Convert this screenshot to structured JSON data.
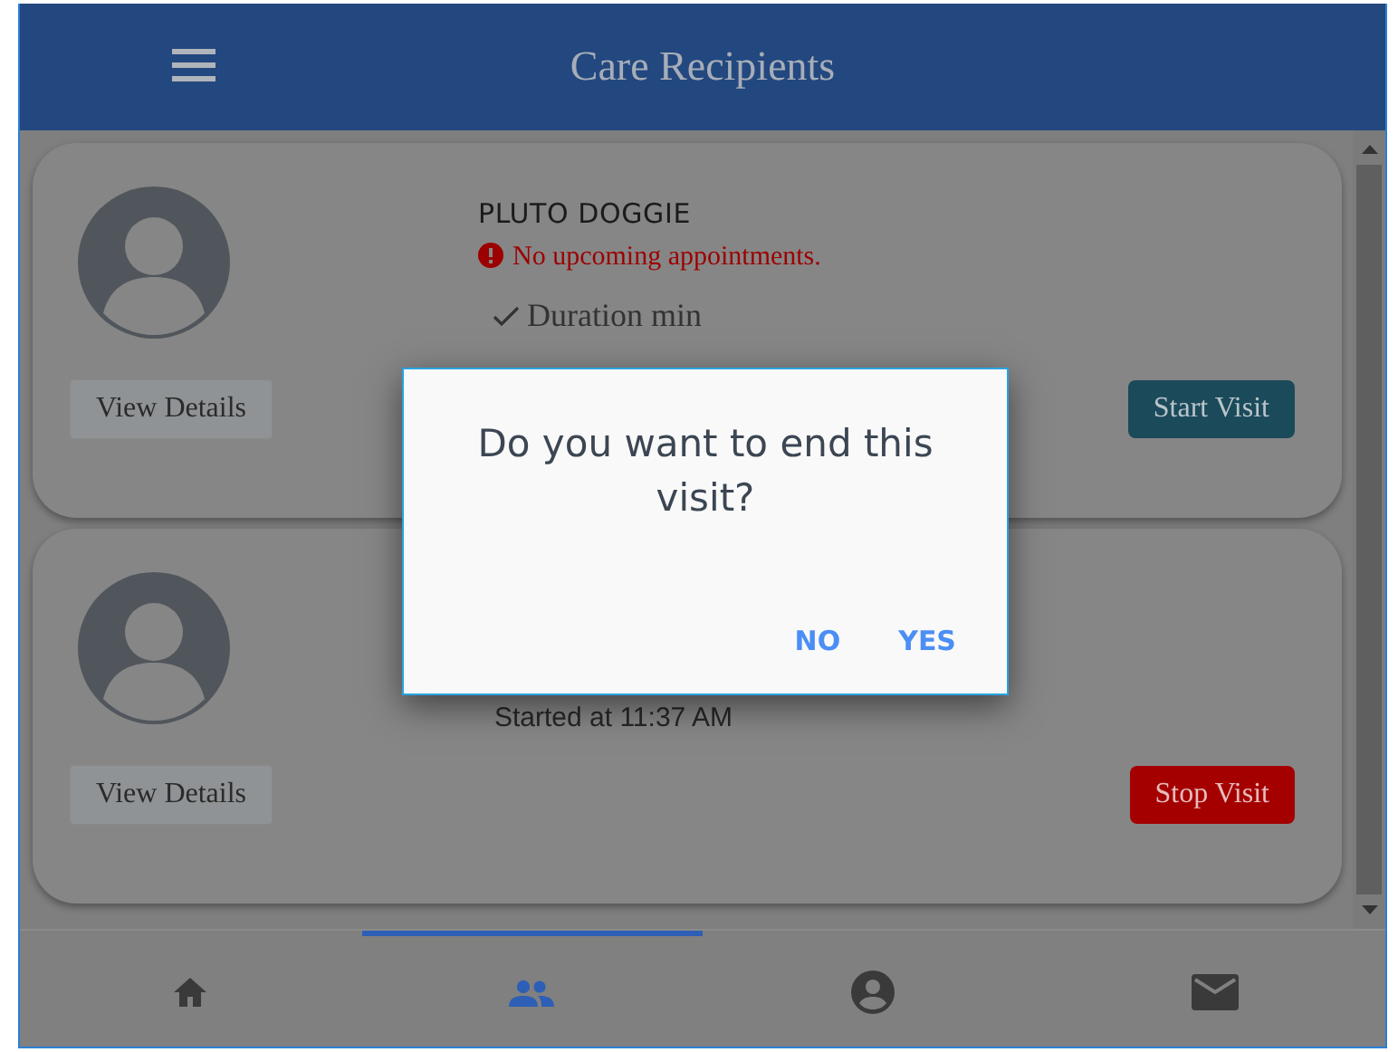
{
  "header": {
    "title": "Care Recipients"
  },
  "recipients": [
    {
      "name": "PLUTO DOGGIE",
      "status": "No upcoming appointments.",
      "detail": "Duration min",
      "checked": true,
      "details_button": "View Details",
      "action": {
        "label": "Start Visit",
        "kind": "start"
      }
    },
    {
      "detail": "Started at 11:37 AM",
      "checked": false,
      "details_button": "View Details",
      "action": {
        "label": "Stop Visit",
        "kind": "stop"
      }
    }
  ],
  "dialog": {
    "message": "Do you want to end this visit?",
    "buttons": [
      "NO",
      "YES"
    ]
  },
  "nav": [
    {
      "kind": "home",
      "selected": false
    },
    {
      "kind": "people",
      "selected": true
    },
    {
      "kind": "account",
      "selected": false
    },
    {
      "kind": "mail",
      "selected": false
    }
  ]
}
